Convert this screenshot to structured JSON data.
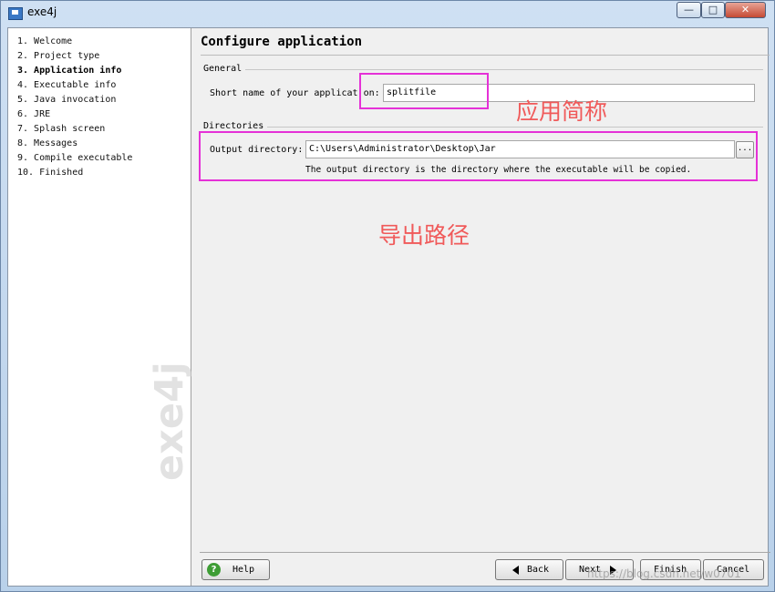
{
  "window": {
    "title": "exe4j",
    "minimize_glyph": "—",
    "maximize_glyph": "□",
    "close_glyph": "✕"
  },
  "sidebar": {
    "steps": [
      {
        "label": "1.  Welcome",
        "current": false
      },
      {
        "label": "2.  Project type",
        "current": false
      },
      {
        "label": "3.  Application info",
        "current": true
      },
      {
        "label": "4.  Executable info",
        "current": false
      },
      {
        "label": "5.  Java invocation",
        "current": false
      },
      {
        "label": "6.  JRE",
        "current": false
      },
      {
        "label": "7.  Splash screen",
        "current": false
      },
      {
        "label": "8.  Messages",
        "current": false
      },
      {
        "label": "9.  Compile executable",
        "current": false
      },
      {
        "label": "10.  Finished",
        "current": false
      }
    ],
    "watermark": "exe4j"
  },
  "main": {
    "title": "Configure application",
    "general": {
      "group_label": "General",
      "short_name_label": "Short name of your applicat on:",
      "short_name_value": "splitfile"
    },
    "directories": {
      "group_label": "Directories",
      "output_label": "Output directory:",
      "output_value": "C:\\Users\\Administrator\\Desktop\\Jar",
      "browse_label": "...",
      "hint": "The output directory is the directory where the executable will be copied."
    }
  },
  "annotations": {
    "short_name_note": "应用简称",
    "output_note": "导出路径",
    "highlight_color": "#e531d7",
    "note_color": "#f05a5a"
  },
  "buttons": {
    "help": "Help",
    "help_icon": "?",
    "back": "Back",
    "next": "Next",
    "finish": "Finish",
    "cancel": "Cancel"
  },
  "url_watermark": "https://blog.csdn.net/w0701"
}
